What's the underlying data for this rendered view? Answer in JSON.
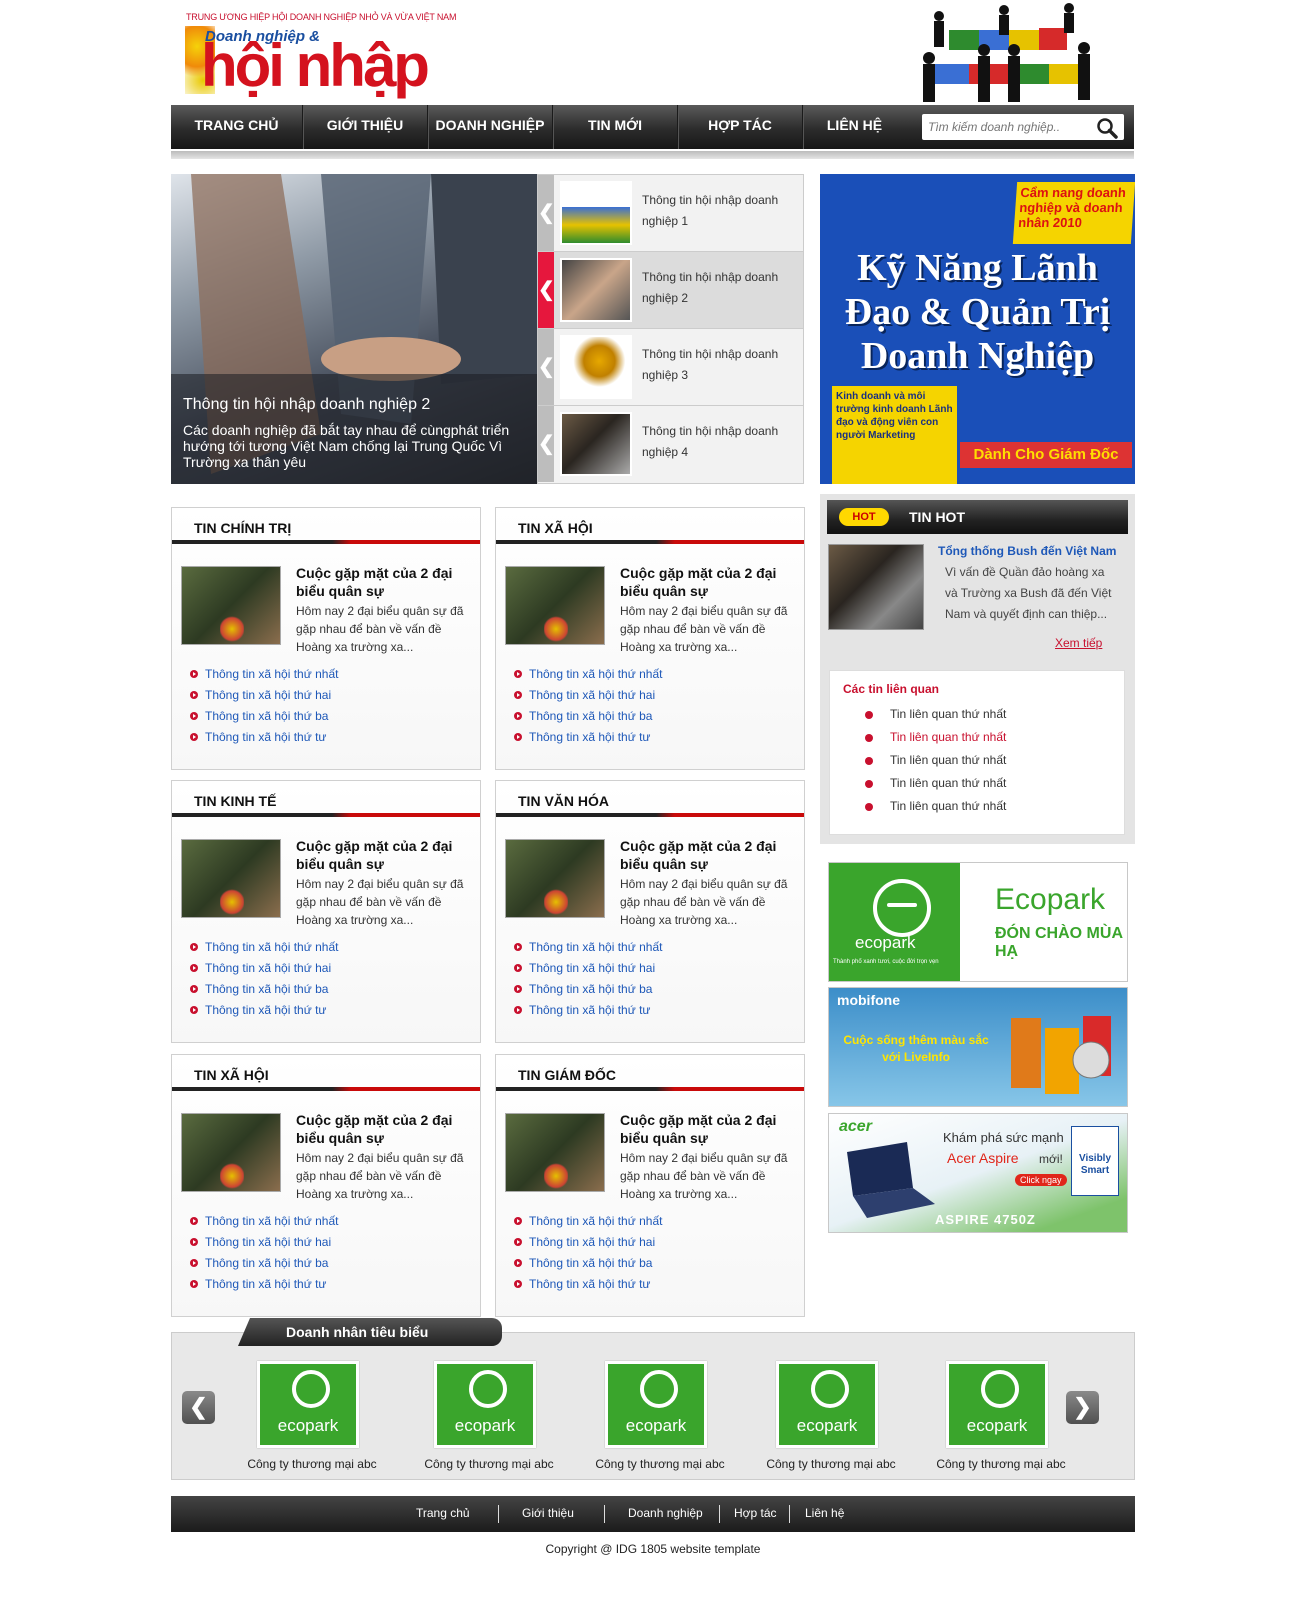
{
  "header": {
    "org": "TRUNG ƯƠNG HIỆP HỘI DOANH NGHIỆP NHỎ VÀ VỪA VIỆT NAM",
    "logo_top": "Doanh nghiệp &",
    "logo_main": "hội nhập"
  },
  "nav": {
    "items": [
      "TRANG CHỦ",
      "GIỚI THIỆU",
      "DOANH NGHIỆP",
      "TIN MỚI",
      "HỢP TÁC",
      "LIÊN HỆ"
    ],
    "search_placeholder": "Tìm kiếm doanh nghiệp.."
  },
  "slider": {
    "title": "Thông tin hội nhập doanh nghiệp 2",
    "desc": "Các doanh nghiệp đã bắt tay nhau để cùngphát triển hướng tới tương Việt Nam chống lại Trung Quốc Vì Trường xa thân yêu",
    "thumbs": [
      "Thông tin hội nhập doanh nghiệp 1",
      "Thông tin hội nhập doanh nghiệp 2",
      "Thông tin hội nhập doanh nghiệp 3",
      "Thông tin hội nhập doanh nghiệp 4"
    ],
    "active_index": 1
  },
  "book_ad": {
    "badge": "Cẩm nang doanh nghiệp và doanh nhân 2010",
    "title": "Kỹ Năng Lãnh Đạo & Quản Trị Doanh Nghiệp",
    "bullets": "Kinh doanh và môi trường kinh doanh Lãnh đạo và động viên con người Marketing",
    "sub": "Dành Cho Giám Đốc"
  },
  "sections": [
    {
      "title": "TIN CHÍNH TRỊ"
    },
    {
      "title": "TIN XÃ HỘI"
    },
    {
      "title": "TIN KINH TẾ"
    },
    {
      "title": "TIN VĂN HÓA"
    },
    {
      "title": "TIN XÃ HỘI"
    },
    {
      "title": "TIN GIÁM ĐỐC"
    }
  ],
  "article": {
    "headline": "Cuộc gặp mặt của 2 đại biểu quân sự",
    "summary": "Hôm nay 2 đại biểu quân sự đã gặp nhau để bàn về vấn đề Hoàng xa trường xa...",
    "links": [
      "Thông tin xã hội thứ nhất",
      "Thông tin xã hội thứ hai",
      "Thông tin xã hội thứ ba",
      "Thông tin xã hội thứ tư"
    ]
  },
  "hot": {
    "badge": "HOT",
    "title": "TIN HOT",
    "headline": "Tổng thống Bush đến Việt Nam",
    "summary": "Vì vấn đề Quần đảo hoàng xa và Trường xa Bush đã đến Việt Nam và quyết định can thiệp...",
    "more": "Xem tiếp",
    "related_title": "Các tin liên quan",
    "related": [
      "Tin liên quan thứ nhất",
      "Tin liên quan thứ nhất",
      "Tin liên quan thứ nhất",
      "Tin liên quan thứ nhất",
      "Tin liên quan thứ nhất"
    ]
  },
  "ads": {
    "ecopark_brand": "ecopark",
    "ecopark_tag": "Thành phố xanh tươi, cuộc đời trọn vẹn",
    "ecopark_name": "Ecopark",
    "ecopark_slogan": "ĐÓN CHÀO MÙA HẠ",
    "mobifone_brand": "mobifone",
    "mobifone_text": "Cuộc sống thêm màu sắc với LiveInfo",
    "acer_brand": "acer",
    "acer_text1": "Khám phá sức mạnh",
    "acer_text2": "Acer Aspire",
    "acer_text3": "mới!",
    "acer_click": "Click ngay",
    "acer_model": "ASPIRE 4750Z",
    "acer_badge": "Visibly Smart"
  },
  "carousel": {
    "title": "Doanh nhân tiêu biểu",
    "brand": "ecopark",
    "items": [
      "Công ty thương mại abc",
      "Công ty thương mại abc",
      "Công ty thương mại abc",
      "Công ty thương mại abc",
      "Công ty thương mại abc"
    ]
  },
  "footer": {
    "links": [
      "Trang chủ",
      "Giới thiệu",
      "Doanh nghiệp",
      "Hợp tác",
      "Liên hệ"
    ],
    "copyright": "Copyright @ IDG 1805 website template"
  }
}
